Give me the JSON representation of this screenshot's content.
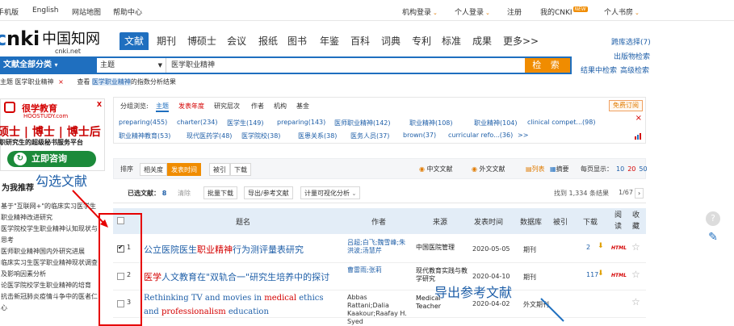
{
  "topbar": {
    "mobile": "手机版",
    "english": "English",
    "sitemap": "网站地图",
    "help": "帮助中心",
    "org_login": "机构登录",
    "personal_login": "个人登录",
    "register": "注册",
    "my_cnki": "我的CNKI",
    "new_badge": "NEW",
    "personal_library": "个人书房"
  },
  "logo": {
    "text": "cnki.net"
  },
  "nav": {
    "tabs": [
      "文献",
      "期刊",
      "博硕士",
      "会议",
      "报纸",
      "图书",
      "年鉴",
      "百科",
      "词典",
      "专利",
      "标准",
      "成果",
      "更多>>"
    ],
    "active": 0
  },
  "right_links": {
    "cross_db": "跨库选择(7)",
    "publication_search": "出版物检索",
    "in_result": "结果中检索",
    "advanced": "高级检索"
  },
  "search": {
    "category": "文献全部分类",
    "field": "主题",
    "query": "医学职业精神",
    "button": "检 索"
  },
  "subline": {
    "topic_prefix": "主题",
    "topic_value": "医学职业精神",
    "remove": "×",
    "view_prefix": "查看",
    "view_keyword": "医学职业精神",
    "view_suffix": "的指数分析结果"
  },
  "ad": {
    "brand": "很学教育",
    "brand_en": "HOOSTUDY.com",
    "line1": "硕士 | 博士 | 博士后",
    "line2": "职研究生的超级秘书服务平台",
    "cta": "立即咨询",
    "close": "X"
  },
  "recommend": {
    "title": "为我推荐",
    "items": [
      "基于\"互联网+\"的临床实习医学生",
      "职业精神改进研究",
      "医学院校学生职业精神认知现状与",
      "思考",
      "医师职业精神国内外研究进展",
      "临床实习生医学职业精神现状调查",
      "及影响因素分析",
      "论医学院校学生职业精神的培育",
      "抗击新冠肺炎疫情斗争中的医者仁",
      "心"
    ]
  },
  "groups": {
    "tabs": [
      "分组浏览:",
      "主题",
      "发表年度",
      "研究层次",
      "作者",
      "机构",
      "基金"
    ],
    "active_tab": 1,
    "highlight_tab": 2,
    "free_subscribe": "免费订阅",
    "close": "×",
    "chips_row1": [
      "preparing(455)",
      "charter(234)",
      "医学生(149)",
      "preparing(143)",
      "医师职业精神(142)",
      "职业精神(108)",
      "职业精神(104)",
      "clinical compet...(98)"
    ],
    "chips_row2": [
      "职业精神教育(53)",
      "现代医药学(48)",
      "医学院校(38)",
      "医患关系(38)",
      "医务人员(37)",
      "brown(37)",
      "curricular refo...(36)",
      ">>"
    ]
  },
  "sort": {
    "label": "排序",
    "options": [
      "相关度",
      "发表时间",
      "被引",
      "下载"
    ],
    "active": 1,
    "chinese": "中文文献",
    "foreign": "外文文献",
    "list": "列表",
    "abstract": "摘要",
    "per_page_label": "每页显示：",
    "per_page": [
      "10",
      "20",
      "50"
    ],
    "per_page_active": 1
  },
  "selection": {
    "selected_label": "已选文献：",
    "selected_count": "8",
    "clear": "清除",
    "batch_download": "批量下载",
    "export": "导出/参考文献",
    "visualize": "计量可视化分析",
    "found": "找到 1,334 条结果",
    "page": "1/67",
    "next": "›"
  },
  "table": {
    "headers": [
      "题名",
      "作者",
      "来源",
      "发表时间",
      "数据库",
      "被引",
      "下载",
      "阅读",
      "收藏"
    ],
    "rows": [
      {
        "num": "1",
        "checked": true,
        "title_parts": [
          {
            "t": "公立医院医生",
            "k": false
          },
          {
            "t": "职业精神",
            "k": true
          },
          {
            "t": "行为测评量表研究",
            "k": false
          }
        ],
        "authors": "吕超;白飞;魏雪峰;朱洪波;汤慧芹",
        "source": "中国医院管理",
        "date": "2020-05-05",
        "db": "期刊",
        "cited": "",
        "downloads": "2",
        "html": "HTML"
      },
      {
        "num": "2",
        "checked": false,
        "title_parts": [
          {
            "t": "医学",
            "k": true
          },
          {
            "t": "人文教育在\"双轨合一\"研究生培养中的探讨",
            "k": false
          }
        ],
        "authors": "曹雷雨;张莉",
        "source": "现代教育实践与教学研究",
        "date": "2020-04-10",
        "db": "期刊",
        "cited": "",
        "downloads": "117",
        "html": "HTML"
      },
      {
        "num": "3",
        "checked": false,
        "title_parts": [
          {
            "t": "Rethinking TV and movies in ",
            "k": false
          },
          {
            "t": "medical",
            "k": true
          },
          {
            "t": " ethics",
            "k": false
          }
        ],
        "title_line2_parts": [
          {
            "t": "and ",
            "k": false
          },
          {
            "t": "professionalism",
            "k": true
          },
          {
            "t": " education",
            "k": false
          }
        ],
        "authors": "Abbas Rattani;Dalia Kaakour;Raafay H. Syed",
        "source": "Medical Teacher",
        "date": "2020-04-02",
        "db": "外文期刊",
        "cited": "",
        "downloads": "",
        "html": ""
      }
    ]
  },
  "annotations": {
    "select": "勾选文献",
    "export": "导出参考文献"
  },
  "colors": {
    "brand_blue": "#1f6fbf",
    "search_orange": "#f08c00",
    "highlight_red": "#d40000",
    "annotation_red": "#e60000",
    "annotation_blue": "#1f5fa8"
  }
}
